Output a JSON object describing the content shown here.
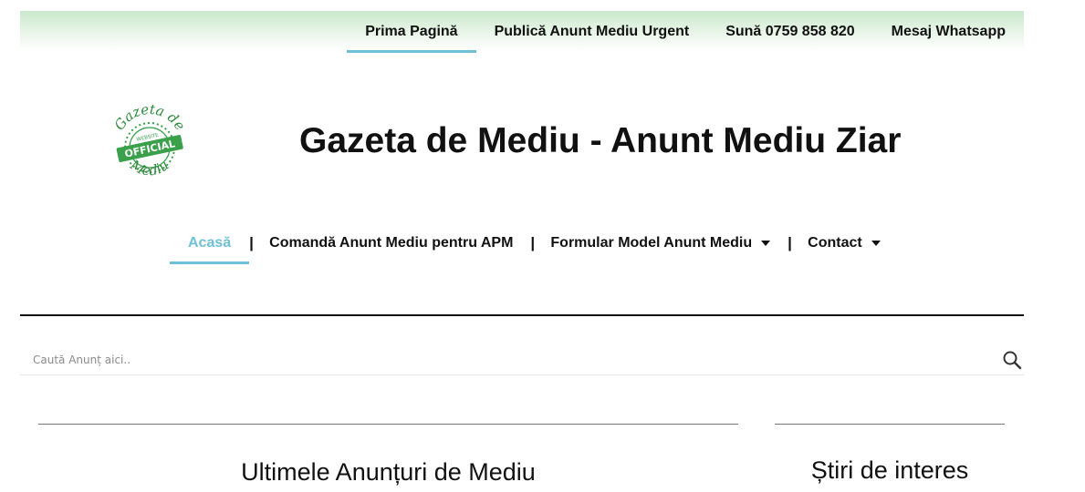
{
  "topnav": {
    "items": [
      {
        "label": "Prima Pagină",
        "active": true
      },
      {
        "label": "Publică Anunt Mediu Urgent"
      },
      {
        "label": "Sună 0759 858 820"
      },
      {
        "label": "Mesaj Whatsapp"
      }
    ]
  },
  "logo": {
    "top_text": "Gazeta de",
    "ribbon_small": "WEBSITE",
    "ribbon_big": "OFFICIAL",
    "bottom_text": "Mediu",
    "color": "#3aa04a"
  },
  "site_title": "Gazeta de Mediu - Anunt Mediu Ziar",
  "mainnav": {
    "items": [
      {
        "label": "Acasă",
        "active": true
      },
      {
        "label": "Comandă Anunt Mediu pentru APM"
      },
      {
        "label": "Formular Model Anunt Mediu",
        "has_dropdown": true
      },
      {
        "label": "Contact",
        "has_dropdown": true
      }
    ],
    "separator": "|"
  },
  "search": {
    "placeholder": "Caută Anunț aici..",
    "value": "",
    "icon": "search-icon"
  },
  "sections": {
    "left_heading": "Ultimele Anunțuri de Mediu",
    "right_heading": "Știri de interes"
  },
  "colors": {
    "accent": "#6fc0d6",
    "topbar_green": "#c9e8cc",
    "text": "#111111"
  }
}
